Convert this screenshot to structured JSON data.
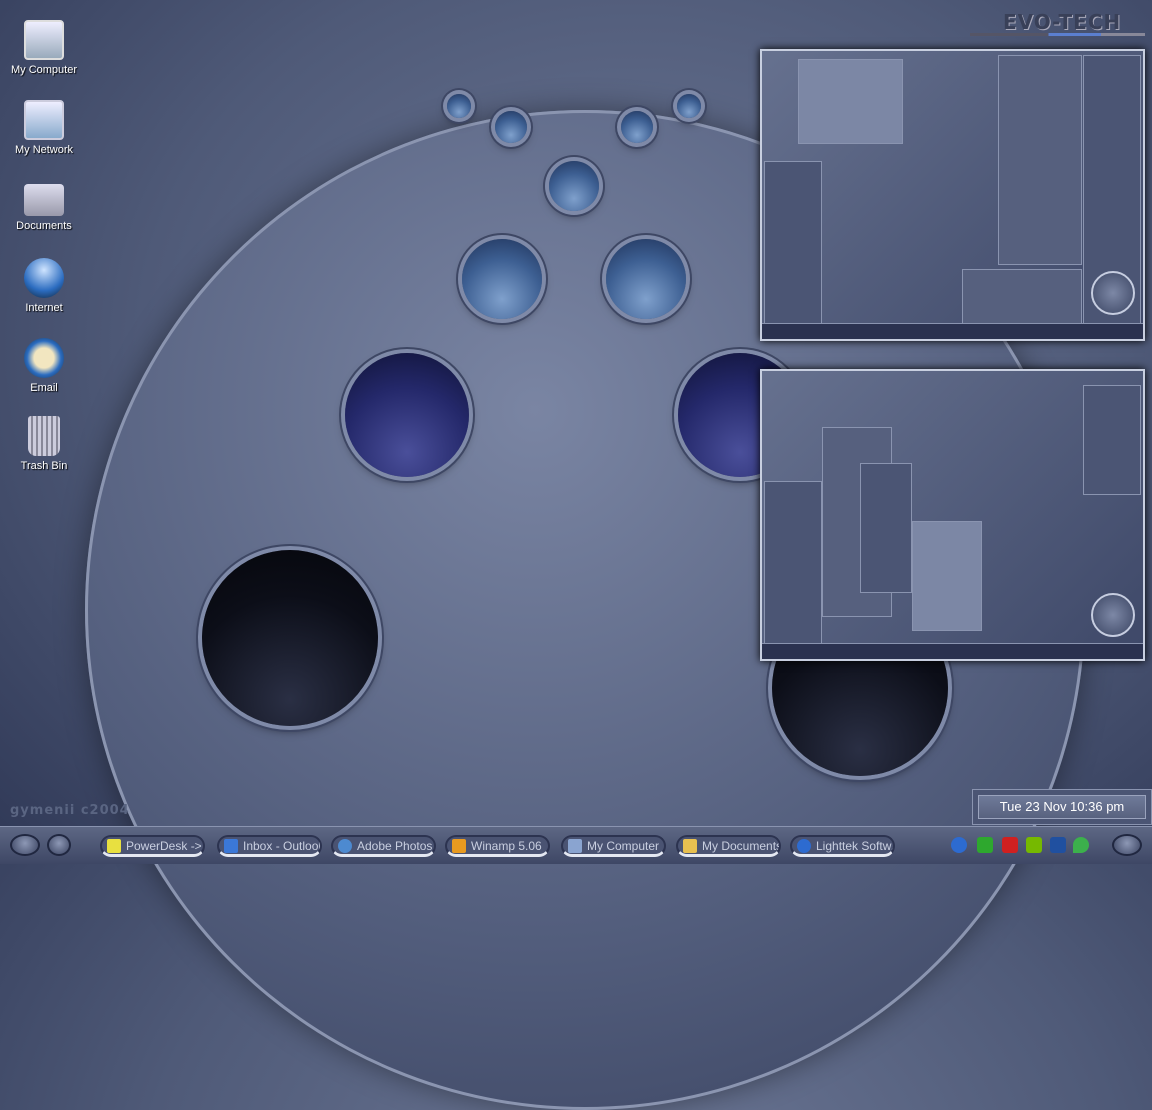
{
  "desktop": {
    "icons": [
      {
        "label": "My Computer",
        "icon": "computer-icon"
      },
      {
        "label": "My Network",
        "icon": "network-icon"
      },
      {
        "label": "Documents",
        "icon": "documents-icon"
      },
      {
        "label": "Internet",
        "icon": "globe-icon"
      },
      {
        "label": "Email",
        "icon": "email-icon"
      },
      {
        "label": "Trash Bin",
        "icon": "trash-icon"
      }
    ],
    "logo": "EVO-TECH",
    "signature": "gymenii c2004"
  },
  "clock": {
    "text": "Tue 23 Nov  10:36 pm"
  },
  "taskbar": {
    "tasks": [
      {
        "label": "PowerDesk -> ...",
        "icon": "powerdesk-icon",
        "color": "#e8e040"
      },
      {
        "label": "Inbox - Outlook...",
        "icon": "outlook-icon",
        "color": "#3b78d8"
      },
      {
        "label": "Adobe Photos...",
        "icon": "photoshop-icon",
        "color": "#4d8ad0"
      },
      {
        "label": "Winamp 5.06",
        "icon": "winamp-icon",
        "color": "#e89a20"
      },
      {
        "label": "My Computer",
        "icon": "computer-icon",
        "color": "#8aa4d0"
      },
      {
        "label": "My Documents",
        "icon": "folder-icon",
        "color": "#e8c050"
      },
      {
        "label": "Lighttek Softw...",
        "icon": "maxthon-icon",
        "color": "#2d6bd0"
      }
    ],
    "tray": [
      {
        "icon": "maxthon-tray-icon",
        "color": "#2d6bd0"
      },
      {
        "icon": "add-tray-icon",
        "color": "#2ea82e"
      },
      {
        "icon": "kaspersky-tray-icon",
        "color": "#d02020"
      },
      {
        "icon": "nvidia-tray-icon",
        "color": "#76b900"
      },
      {
        "icon": "cursor-tray-icon",
        "color": "#2050a0"
      },
      {
        "icon": "leaf-tray-icon",
        "color": "#3cb04c"
      }
    ]
  }
}
